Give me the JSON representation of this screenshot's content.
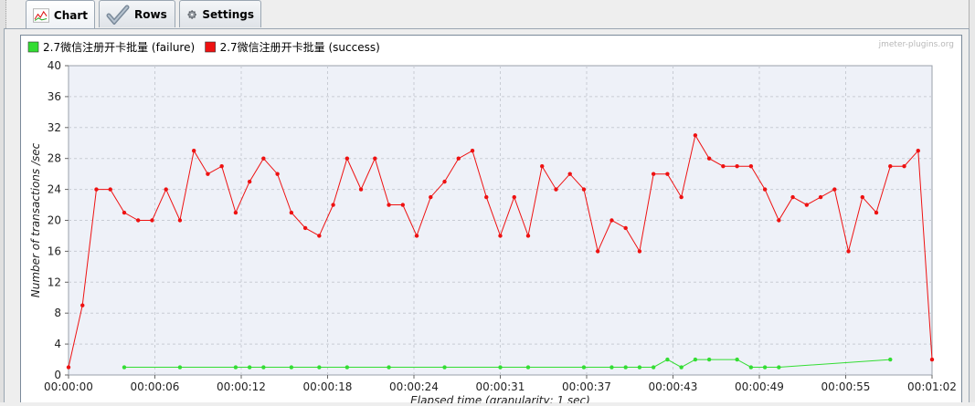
{
  "tabs": [
    {
      "label": "Chart",
      "icon": "chart-icon",
      "active": true
    },
    {
      "label": "Rows",
      "icon": "checkmark-icon",
      "active": false
    },
    {
      "label": "Settings",
      "icon": "gear-icon",
      "active": false
    }
  ],
  "watermark": "jmeter-plugins.org",
  "colors": {
    "failure": "#33dd33",
    "success": "#ee1111",
    "plot_bg": "#eef1f8",
    "grid": "#c8ccd4"
  },
  "chart_data": {
    "type": "line",
    "xlabel": "Elapsed time (granularity: 1 sec)",
    "ylabel": "Number of transactions /sec",
    "ylim": [
      0,
      40
    ],
    "yticks": [
      "0",
      "4",
      "8",
      "12",
      "16",
      "20",
      "24",
      "28",
      "32",
      "36",
      "40"
    ],
    "xlim": [
      0,
      62
    ],
    "xticks": [
      {
        "t": 0,
        "label": "00:00:00"
      },
      {
        "t": 6.2,
        "label": "00:00:06"
      },
      {
        "t": 12.4,
        "label": "00:00:12"
      },
      {
        "t": 18.6,
        "label": "00:00:18"
      },
      {
        "t": 24.8,
        "label": "00:00:24"
      },
      {
        "t": 31,
        "label": "00:00:31"
      },
      {
        "t": 37.2,
        "label": "00:00:37"
      },
      {
        "t": 43.4,
        "label": "00:00:43"
      },
      {
        "t": 49.6,
        "label": "00:00:49"
      },
      {
        "t": 55.8,
        "label": "00:00:55"
      },
      {
        "t": 62,
        "label": "00:01:02"
      }
    ],
    "legend_position": "top-left",
    "series": [
      {
        "name": "2.7微信注册开卡批量 (failure)",
        "color": "#33dd33",
        "x": [
          4,
          8,
          12,
          13,
          14,
          16,
          18,
          20,
          23,
          27,
          31,
          33,
          37,
          39,
          40,
          41,
          42,
          43,
          44,
          45,
          46,
          48,
          49,
          50,
          51,
          59
        ],
        "values": [
          1,
          1,
          1,
          1,
          1,
          1,
          1,
          1,
          1,
          1,
          1,
          1,
          1,
          1,
          1,
          1,
          1,
          2,
          1,
          2,
          2,
          2,
          1,
          1,
          1,
          2
        ]
      },
      {
        "name": "2.7微信注册开卡批量 (success)",
        "color": "#ee1111",
        "x": [
          0,
          1,
          2,
          3,
          4,
          5,
          6,
          7,
          8,
          9,
          10,
          11,
          12,
          13,
          14,
          15,
          16,
          17,
          18,
          19,
          20,
          21,
          22,
          23,
          24,
          25,
          26,
          27,
          28,
          29,
          30,
          31,
          32,
          33,
          34,
          35,
          36,
          37,
          38,
          39,
          40,
          41,
          42,
          43,
          44,
          45,
          46,
          47,
          48,
          49,
          50,
          51,
          52,
          53,
          54,
          55,
          56,
          57,
          58,
          59,
          60,
          61,
          62
        ],
        "values": [
          1,
          9,
          24,
          24,
          21,
          20,
          20,
          24,
          20,
          29,
          26,
          27,
          21,
          25,
          28,
          26,
          21,
          19,
          18,
          22,
          28,
          24,
          28,
          22,
          22,
          18,
          23,
          25,
          28,
          29,
          23,
          18,
          23,
          18,
          27,
          24,
          26,
          24,
          16,
          20,
          19,
          16,
          26,
          26,
          23,
          31,
          28,
          27,
          27,
          27,
          24,
          20,
          23,
          22,
          23,
          24,
          16,
          23,
          21,
          27,
          27,
          29,
          2
        ]
      }
    ]
  }
}
